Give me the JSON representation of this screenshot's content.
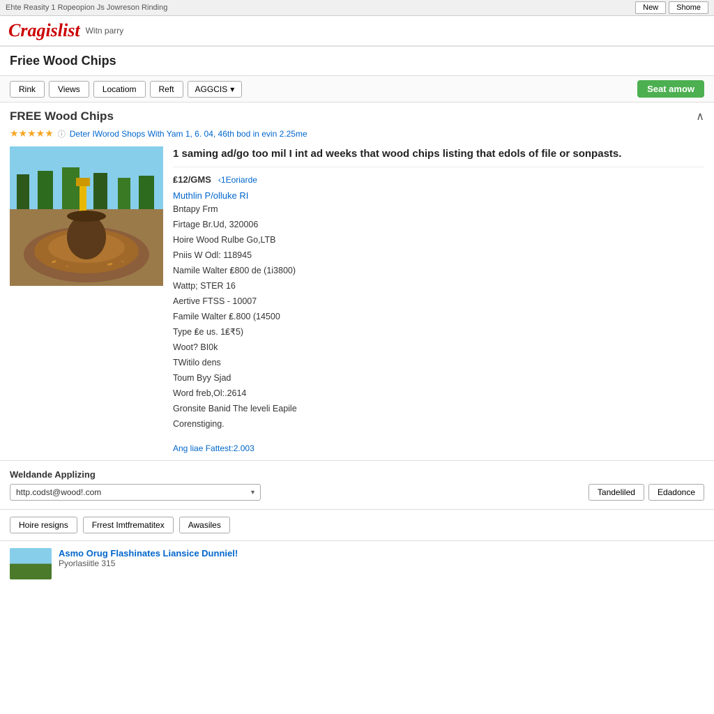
{
  "topnav": {
    "left_text": "Ehte Reasity 1 Ropeopion Js Jowreson Rinding",
    "btn_new": "New",
    "btn_shome": "Shome"
  },
  "logo": {
    "text": "Cragislist",
    "sub": "Witn parry"
  },
  "page": {
    "title": "Friee Wood Chips"
  },
  "toolbar": {
    "btn_rink": "Rink",
    "btn_views": "Views",
    "btn_location": "Locatiom",
    "btn_reft": "Reft",
    "btn_aggcis": "AGGCIS",
    "btn_seat": "Seat amow"
  },
  "listing": {
    "title": "FREE Wood Chips",
    "stars": "★★★★★",
    "rating_text": "Deter IWorod Shops With Yam 1, 6. 04, 46th bod in evin 2.25me",
    "body_title": "1 saming ad/go too mil I int ad weeks that wood chips listing that edols of file or sonpasts.",
    "price": "₤12/GMS",
    "price_link": "‹1Eoriarde",
    "detail_link": "Muthlin P/olluke RI",
    "line1": "Bntapy Frm",
    "line2": "Firtage Br.Ud, 320006",
    "line3": "Hoire Wood Rulbe Go,LTB",
    "line4": "Pniis W Odl: 118945",
    "line5": "Namile Walter ₤800 de (1i3800)",
    "line6": "Wattp; STER  16",
    "line7": "Aertive FTSS - 10007",
    "line8": "Famile Walter ₤.800 (14500",
    "line9": "Type ₤e us. 1₤₹5)",
    "line10": "Woot? BI0k",
    "line11": "TWitilo dens",
    "line12": "Toum Byy Sjad",
    "line13": "Word freb,Ol:.2614",
    "line14": "Gronsite Banid The leveli Eapile",
    "line15": "Corenstiging.",
    "footer_link": "Ang liae Fattest:2.003"
  },
  "apply": {
    "label": "Weldande Applizing",
    "input_value": "http.codst@wood!.com",
    "btn1": "Tandeliled",
    "btn2": "Edadonce"
  },
  "tags": {
    "btn1": "Hoire resigns",
    "btn2": "Frrest Imtfrematitex",
    "btn3": "Awasiles"
  },
  "related": {
    "title": "Asmo Orug Flashinates Liansice Dunniel!",
    "sub": "Pyorlasiitle 315"
  }
}
